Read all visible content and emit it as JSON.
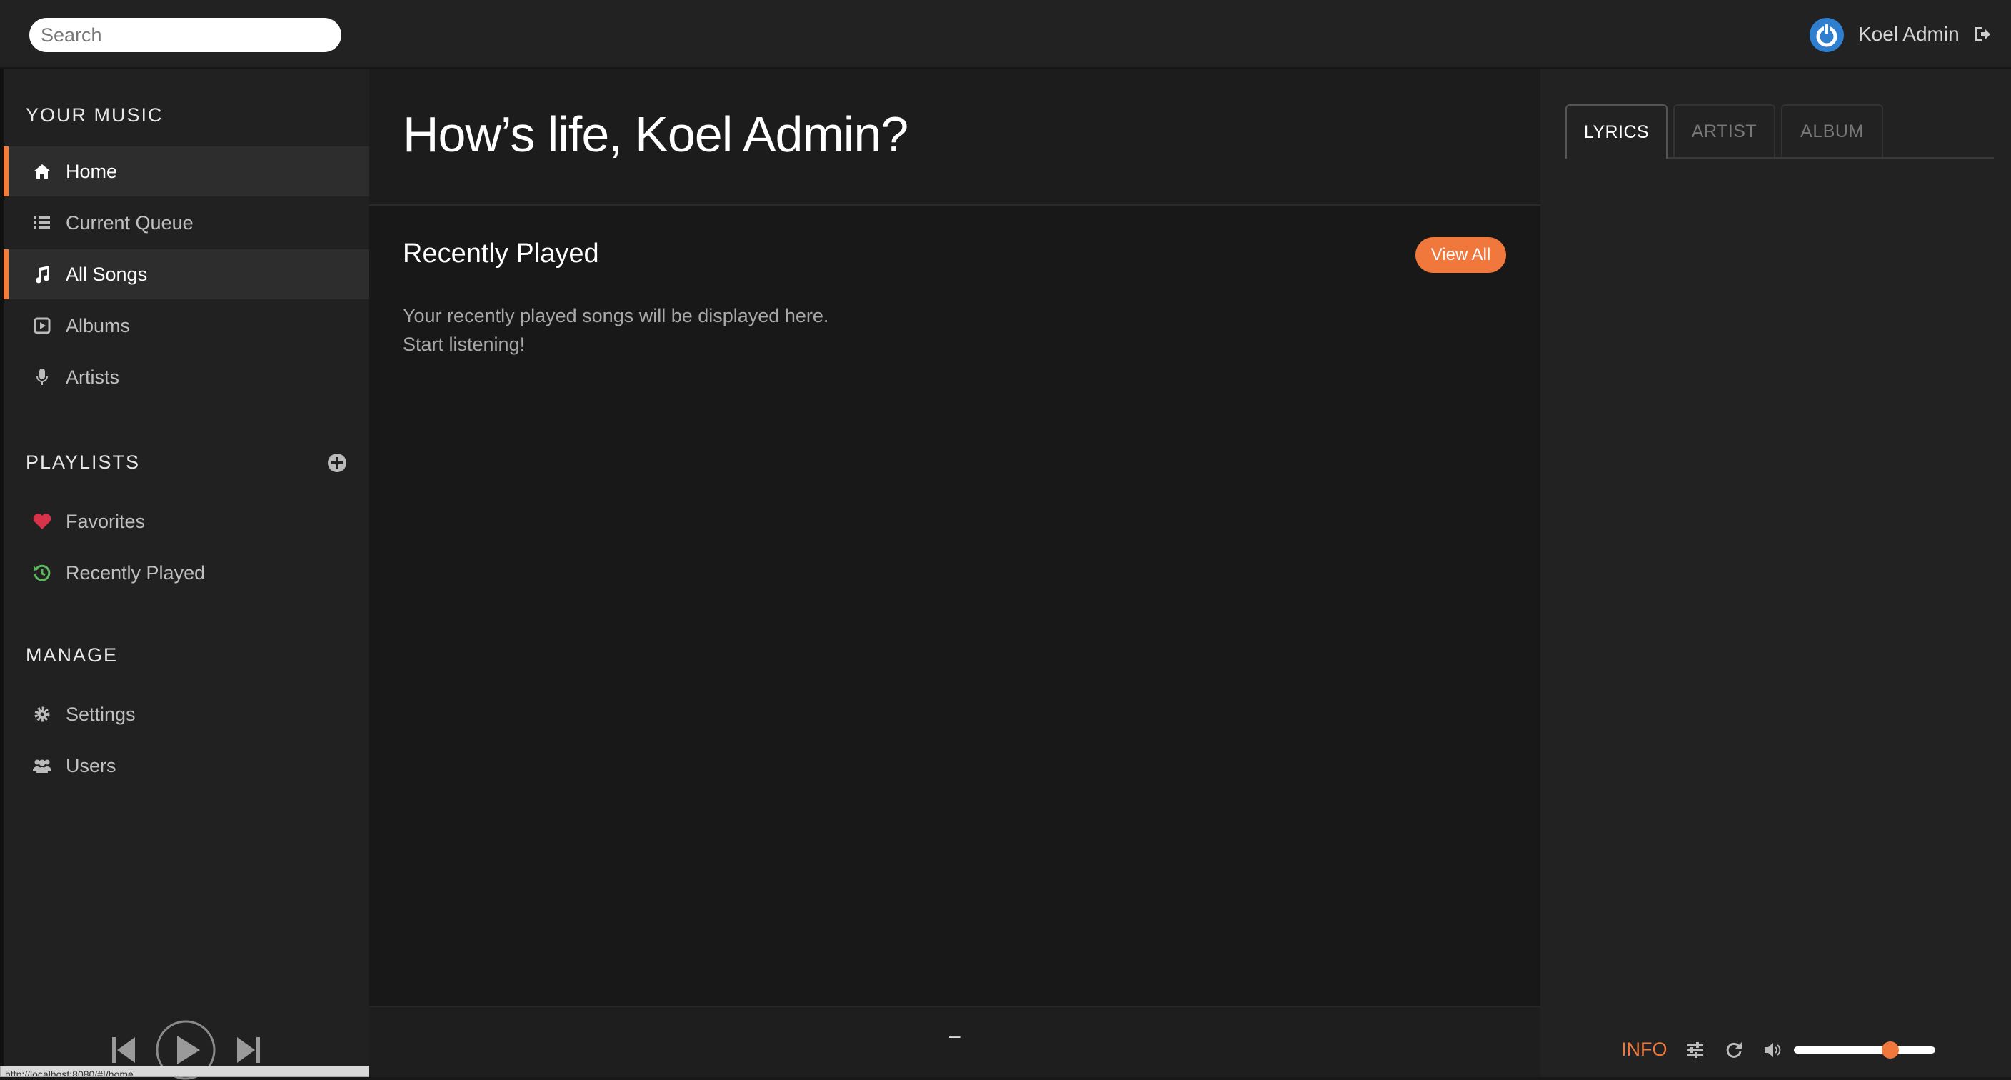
{
  "header": {
    "search_placeholder": "Search",
    "user_name": "Koel Admin"
  },
  "sidebar": {
    "your_music_title": "YOUR MUSIC",
    "music_items": [
      {
        "label": "Home",
        "icon": "home-icon",
        "active": true
      },
      {
        "label": "Current Queue",
        "icon": "list-icon",
        "active": false
      },
      {
        "label": "All Songs",
        "icon": "music-note-icon",
        "active": true
      },
      {
        "label": "Albums",
        "icon": "album-icon",
        "active": false
      },
      {
        "label": "Artists",
        "icon": "microphone-icon",
        "active": false
      }
    ],
    "playlists_title": "PLAYLISTS",
    "playlist_items": [
      {
        "label": "Favorites",
        "icon": "heart-icon"
      },
      {
        "label": "Recently Played",
        "icon": "history-icon"
      }
    ],
    "manage_title": "MANAGE",
    "manage_items": [
      {
        "label": "Settings",
        "icon": "gear-icon"
      },
      {
        "label": "Users",
        "icon": "users-icon"
      }
    ],
    "status_url": "http://localhost:8080/#!/home"
  },
  "main": {
    "greeting": "How’s life, Koel Admin?",
    "recently_played_title": "Recently Played",
    "view_all_label": "View All",
    "empty_line_1": "Your recently played songs will be displayed here.",
    "empty_line_2": "Start listening!",
    "now_playing_text": "–"
  },
  "right_panel": {
    "tabs": [
      {
        "label": "LYRICS",
        "active": true
      },
      {
        "label": "ARTIST",
        "active": false
      },
      {
        "label": "ALBUM",
        "active": false
      }
    ],
    "info_label": "INFO",
    "volume_level": 0.68
  },
  "colors": {
    "accent": "#f0783c",
    "favorite": "#d8334a",
    "recent": "#5cb85c",
    "avatar": "#2f7fd1"
  }
}
